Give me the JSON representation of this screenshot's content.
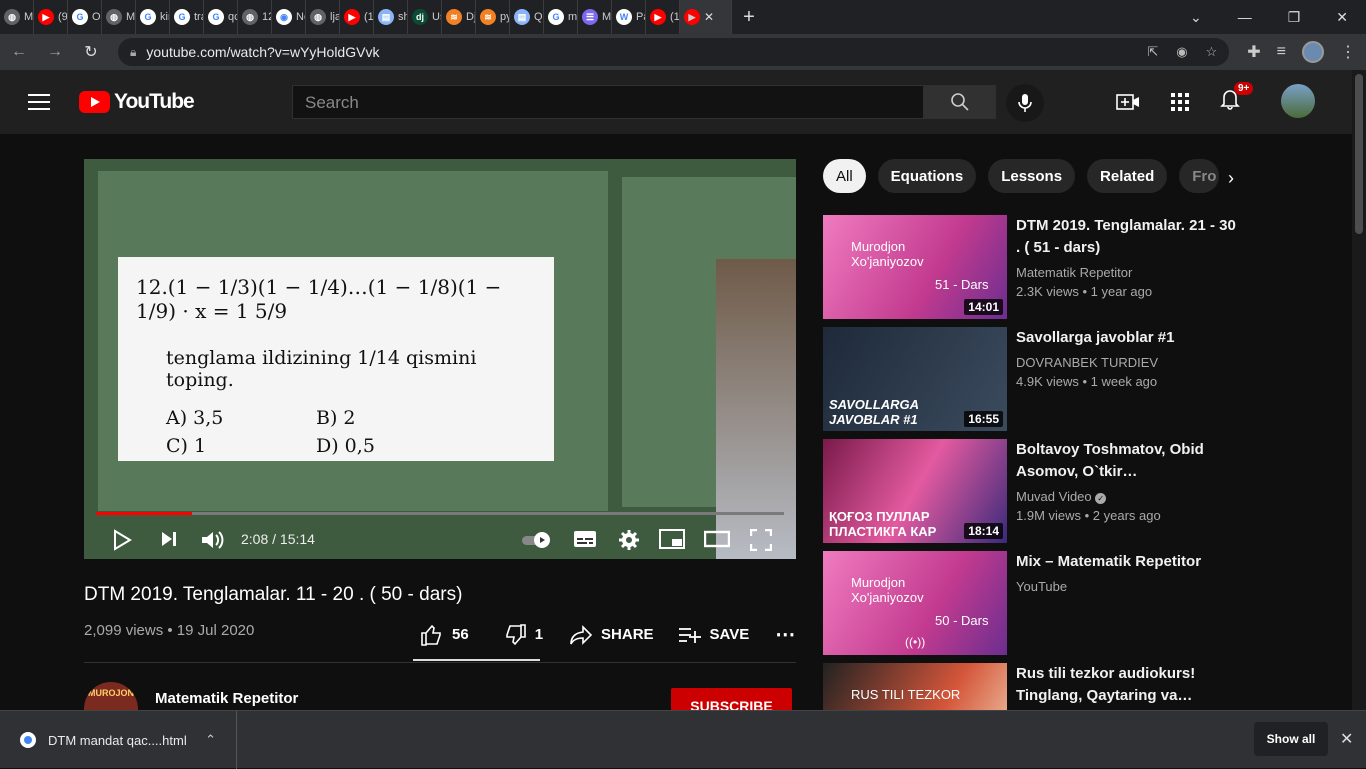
{
  "browser": {
    "tabs": [
      {
        "label": "M",
        "icon": "globe-icon",
        "color": "#5f6368"
      },
      {
        "label": "(9)",
        "icon": "youtube-icon",
        "color": "#ff0000"
      },
      {
        "label": "O'",
        "icon": "google-icon",
        "color": "#ffffff"
      },
      {
        "label": "M",
        "icon": "globe-icon",
        "color": "#5f6368"
      },
      {
        "label": "kir",
        "icon": "google-icon",
        "color": "#ffffff"
      },
      {
        "label": "tra",
        "icon": "google-icon",
        "color": "#ffffff"
      },
      {
        "label": "qc",
        "icon": "google-icon",
        "color": "#ffffff"
      },
      {
        "label": "12",
        "icon": "globe-icon",
        "color": "#5f6368"
      },
      {
        "label": "Ne",
        "icon": "github-icon",
        "color": "#ffffff"
      },
      {
        "label": "lja",
        "icon": "globe-icon",
        "color": "#5f6368"
      },
      {
        "label": "(1(",
        "icon": "youtube-icon",
        "color": "#ff0000"
      },
      {
        "label": "sh",
        "icon": "book-icon",
        "color": "#8ab4f8"
      },
      {
        "label": "Us",
        "icon": "django-icon",
        "color": "#0c4b33"
      },
      {
        "label": "Dj",
        "icon": "stack-icon",
        "color": "#f48024"
      },
      {
        "label": "py",
        "icon": "stack-icon",
        "color": "#f48024"
      },
      {
        "label": "Qu",
        "icon": "book-icon",
        "color": "#8ab4f8"
      },
      {
        "label": "m",
        "icon": "google-icon",
        "color": "#ffffff"
      },
      {
        "label": "M",
        "icon": "list-icon",
        "color": "#7b68ee"
      },
      {
        "label": "Pa",
        "icon": "wiki-icon",
        "color": "#ffffff"
      },
      {
        "label": "(1(",
        "icon": "youtube-icon",
        "color": "#ff0000"
      }
    ],
    "active_tab_close": "✕",
    "new_tab": "+",
    "url": "youtube.com/watch?v=wYyHoldGVvk"
  },
  "youtube": {
    "logo_text": "YouTube",
    "search_placeholder": "Search",
    "notif_count": "9+",
    "player": {
      "problem_line1": "12.(1 − 1/3)(1 − 1/4)…(1 − 1/8)(1 − 1/9) · x = 1 5/9",
      "problem_line2": "tenglama ildizining 1/14 qismini toping.",
      "options": [
        "A) 3,5",
        "B) 2",
        "C) 1",
        "D) 0,5"
      ],
      "time": "2:08 / 15:14",
      "progress": 0.14
    },
    "video": {
      "title": "DTM 2019. Tenglamalar. 11 - 20 . ( 50 - dars)",
      "meta": "2,099 views • 19 Jul 2020",
      "likes": "56",
      "dislikes": "1",
      "share": "SHARE",
      "save": "SAVE",
      "channel": "Matematik Repetitor",
      "subscribe": "SUBSCRIBE",
      "avatar_text": "MUROJON"
    },
    "chips": [
      "All",
      "Equations",
      "Lessons",
      "Related",
      "Fro"
    ],
    "recommendations": [
      {
        "title": "DTM 2019. Tenglamalar.  21 - 30 . ( 51 - dars)",
        "channel": "Matematik Repetitor",
        "meta": "2.3K views • 1 year ago",
        "duration": "14:01",
        "thumb_text": "Murodjon Xo'janiyozov",
        "thumb_sub": "51 - Dars"
      },
      {
        "title": "Savollarga javoblar #1",
        "channel": "DOVRANBEK TURDIEV",
        "meta": "4.9K views • 1 week ago",
        "duration": "16:55",
        "thumb_text": "SAVOLLARGA JAVOBLAR #1",
        "thumb_sub": ""
      },
      {
        "title": "Boltavoy Toshmatov, Obid Asomov, O`tkir…",
        "channel": "Muvad Video",
        "meta": "1.9M views • 2 years ago",
        "duration": "18:14",
        "thumb_text": "ҚОҒОЗ ПУЛЛАР ПЛАСТИКГА КАР",
        "thumb_sub": ""
      },
      {
        "title": "Mix – Matematik Repetitor",
        "channel": "YouTube",
        "meta": "",
        "duration": "",
        "thumb_text": "Murodjon Xo'janiyozov",
        "thumb_sub": "50 - Dars"
      },
      {
        "title": "Rus tili tezkor audiokurs! Tinglang, Qaytaring va…",
        "channel": "",
        "meta": "",
        "duration": "",
        "thumb_text": "RUS TILI TEZKOR",
        "thumb_sub": ""
      }
    ]
  },
  "download": {
    "file": "DTM mandat qac....html",
    "show_all": "Show all"
  }
}
